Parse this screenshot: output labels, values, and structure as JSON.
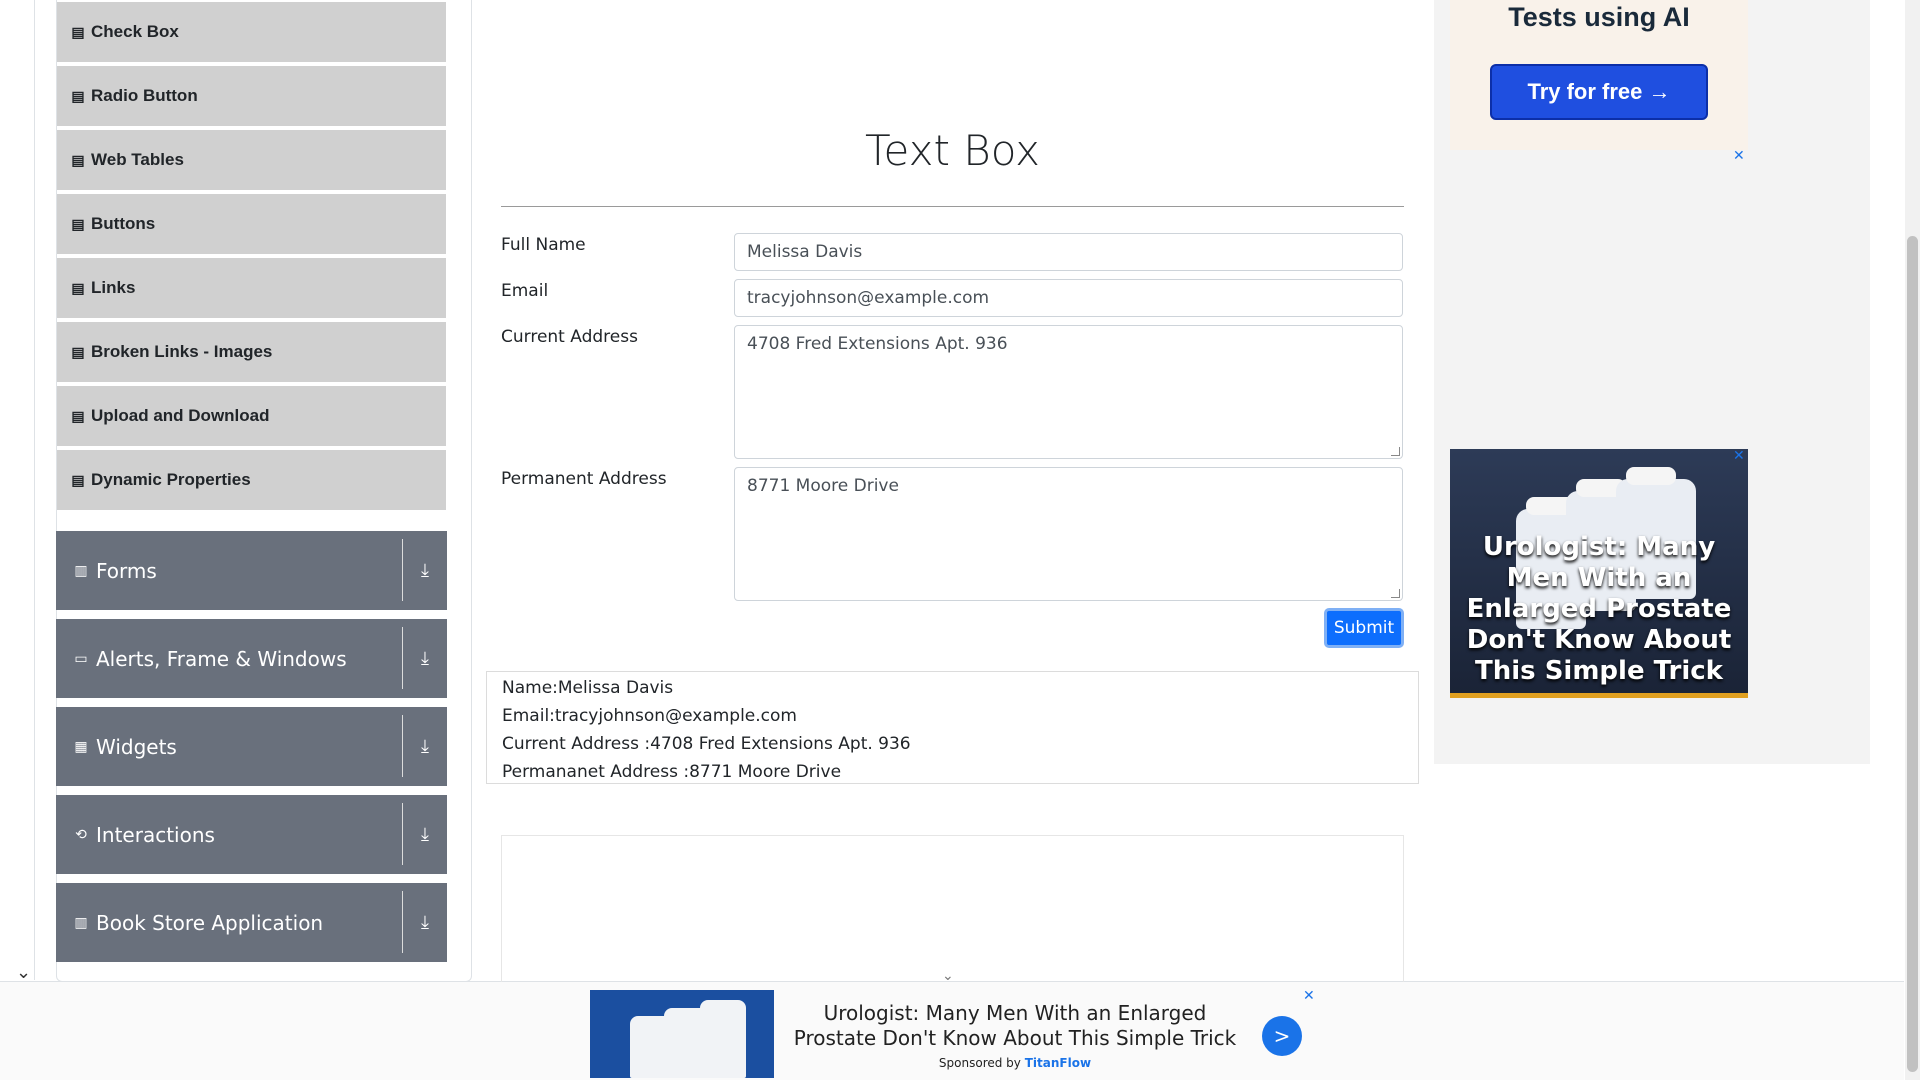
{
  "sidebar": {
    "subitems": [
      {
        "label": "Check Box"
      },
      {
        "label": "Radio Button"
      },
      {
        "label": "Web Tables"
      },
      {
        "label": "Buttons"
      },
      {
        "label": "Links"
      },
      {
        "label": "Broken Links - Images"
      },
      {
        "label": "Upload and Download"
      },
      {
        "label": "Dynamic Properties"
      }
    ],
    "groups": [
      {
        "label": "Forms"
      },
      {
        "label": "Alerts, Frame & Windows"
      },
      {
        "label": "Widgets"
      },
      {
        "label": "Interactions"
      },
      {
        "label": "Book Store Application"
      }
    ]
  },
  "main": {
    "title": "Text Box",
    "labels": {
      "full_name": "Full Name",
      "email": "Email",
      "current_address": "Current Address",
      "permanent_address": "Permanent Address"
    },
    "values": {
      "full_name": "Melissa Davis",
      "email": "tracyjohnson@example.com",
      "current_address": "4708 Fred Extensions Apt. 936",
      "permanent_address": "8771 Moore Drive"
    },
    "submit_label": "Submit",
    "output": {
      "name": "Name:Melissa Davis",
      "email": "Email:tracyjohnson@example.com",
      "current_address": "Current Address :4708 Fred Extensions Apt. 936",
      "permanent_address": "Permananet Address :8771 Moore Drive"
    }
  },
  "ads": {
    "top_ad_title": "Tests using AI",
    "top_ad_button": "Try for free →",
    "side_ad_text": "Urologist: Many Men With an Enlarged Prostate Don't Know About This Simple Trick",
    "banner_text": "Urologist: Many Men With an Enlarged Prostate Don't Know About This Simple Trick",
    "banner_sponsor_prefix": "Sponsored by",
    "banner_sponsor_name": "TitanFlow",
    "close_glyph": "✕",
    "go_glyph": ">"
  },
  "colors": {
    "group_bg": "#69707c",
    "subitem_bg": "#d0d0d0",
    "submit_bg": "#0d6efd",
    "ad_button_bg": "#1f4fe0",
    "link_blue": "#1a73e8"
  },
  "icons": {
    "subitem": "document-icon",
    "download": "download-icon",
    "collapse": "chevron-down-icon"
  }
}
